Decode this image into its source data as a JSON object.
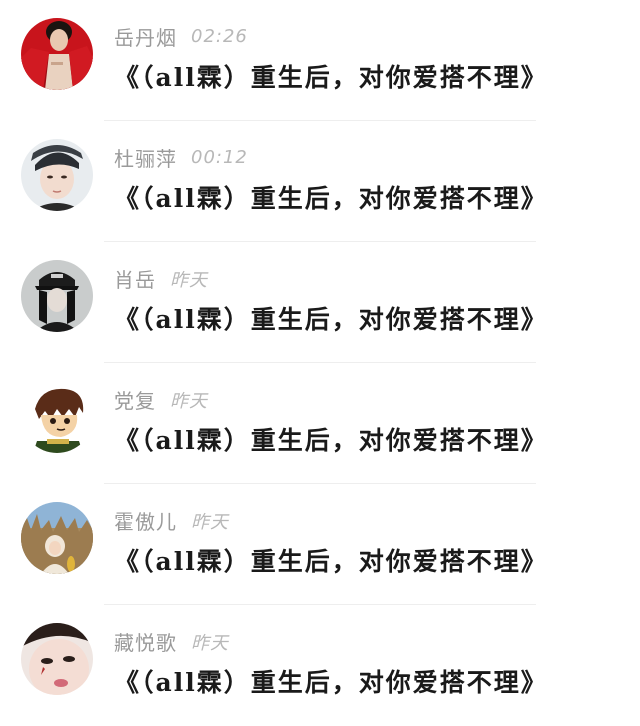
{
  "conversations": [
    {
      "name": "岳丹烟",
      "time": "02:26",
      "message": "《（all霖）重生后，对你爱搭不理》",
      "avatar": "avatar-red-jacket"
    },
    {
      "name": "杜骊萍",
      "time": "00:12",
      "message": "《（all霖）重生后，对你爱搭不理》",
      "avatar": "avatar-cap-boy"
    },
    {
      "name": "肖岳",
      "time": "昨天",
      "message": "《（all霖）重生后，对你爱搭不理》",
      "avatar": "avatar-hat-girl"
    },
    {
      "name": "党复",
      "time": "昨天",
      "message": "《（all霖）重生后，对你爱搭不理》",
      "avatar": "avatar-cartoon-boy"
    },
    {
      "name": "霍傲儿",
      "time": "昨天",
      "message": "《（all霖）重生后，对你爱搭不理》",
      "avatar": "avatar-field-child"
    },
    {
      "name": "藏悦歌",
      "time": "昨天",
      "message": "《（all霖）重生后，对你爱搭不理》",
      "avatar": "avatar-face-closeup"
    }
  ]
}
